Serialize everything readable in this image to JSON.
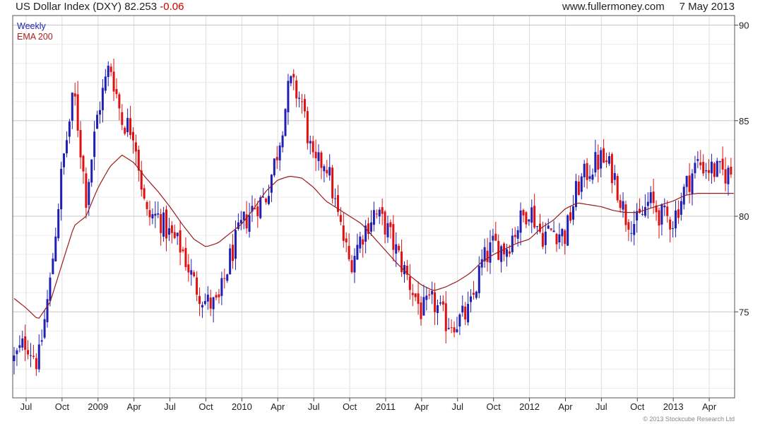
{
  "header": {
    "title": "US Dollar Index (DXY)",
    "last": "82.253",
    "change": "-0.06",
    "source": "www.fullermoney.com",
    "date": "7 May 2013"
  },
  "legend": {
    "series1": "Weekly",
    "series2": "EMA 200"
  },
  "footer": "© 2013 Stockcube Research Ltd",
  "colors": {
    "up": "#1f1fb4",
    "down": "#dd1111",
    "ema": "#9b1c1c",
    "grid": "#dcdcdc"
  },
  "chart_data": {
    "type": "line",
    "title": "US Dollar Index (DXY)",
    "chart_style": "candlestick",
    "ylim": [
      70.5,
      90.5
    ],
    "yticks": [
      75,
      80,
      85,
      90
    ],
    "x_labels": [
      "Jul",
      "Oct",
      "2009",
      "Apr",
      "Jul",
      "Oct",
      "2010",
      "Apr",
      "Jul",
      "Oct",
      "2011",
      "Apr",
      "Jul",
      "Oct",
      "2012",
      "Apr",
      "Jul",
      "Oct",
      "2013",
      "Apr"
    ],
    "x_range": [
      "2008-06",
      "2013-05"
    ],
    "grid": true,
    "axis_side": "right",
    "series": [
      {
        "name": "Weekly",
        "kind": "close",
        "x": [
          "2008-06",
          "2008-07",
          "2008-08",
          "2008-09",
          "2008-10",
          "2008-11",
          "2008-12",
          "2009-01",
          "2009-02",
          "2009-03",
          "2009-04",
          "2009-05",
          "2009-06",
          "2009-07",
          "2009-08",
          "2009-09",
          "2009-10",
          "2009-11",
          "2009-12",
          "2010-01",
          "2010-02",
          "2010-03",
          "2010-04",
          "2010-05",
          "2010-06",
          "2010-07",
          "2010-08",
          "2010-09",
          "2010-10",
          "2010-11",
          "2010-12",
          "2011-01",
          "2011-02",
          "2011-03",
          "2011-04",
          "2011-05",
          "2011-06",
          "2011-07",
          "2011-08",
          "2011-09",
          "2011-10",
          "2011-11",
          "2011-12",
          "2012-01",
          "2012-02",
          "2012-03",
          "2012-04",
          "2012-05",
          "2012-06",
          "2012-07",
          "2012-08",
          "2012-09",
          "2012-10",
          "2012-11",
          "2012-12",
          "2013-01",
          "2013-02",
          "2013-03",
          "2013-04",
          "2013-05"
        ],
        "values": [
          72.5,
          73.5,
          72.3,
          76.5,
          82.5,
          86.5,
          81.0,
          85.5,
          88.0,
          85.0,
          84.5,
          80.0,
          80.0,
          79.0,
          78.3,
          76.5,
          75.5,
          75.3,
          77.8,
          79.5,
          80.5,
          81.0,
          83.5,
          87.0,
          86.0,
          82.5,
          83.0,
          80.0,
          77.5,
          79.0,
          80.2,
          79.5,
          78.0,
          76.5,
          75.0,
          75.5,
          74.5,
          74.5,
          75.0,
          77.5,
          78.5,
          78.3,
          79.5,
          80.5,
          79.0,
          79.3,
          79.0,
          81.5,
          82.5,
          83.0,
          82.3,
          80.0,
          79.6,
          80.8,
          80.0,
          79.8,
          81.5,
          82.8,
          82.5,
          82.25
        ]
      },
      {
        "name": "EMA 200",
        "kind": "line",
        "x": [
          "2008-06",
          "2008-07",
          "2008-08",
          "2008-09",
          "2008-10",
          "2008-11",
          "2008-12",
          "2009-01",
          "2009-02",
          "2009-03",
          "2009-04",
          "2009-05",
          "2009-06",
          "2009-07",
          "2009-08",
          "2009-09",
          "2009-10",
          "2009-11",
          "2009-12",
          "2010-01",
          "2010-02",
          "2010-03",
          "2010-04",
          "2010-05",
          "2010-06",
          "2010-07",
          "2010-08",
          "2010-09",
          "2010-10",
          "2010-11",
          "2010-12",
          "2011-01",
          "2011-02",
          "2011-03",
          "2011-04",
          "2011-05",
          "2011-06",
          "2011-07",
          "2011-08",
          "2011-09",
          "2011-10",
          "2011-11",
          "2011-12",
          "2012-01",
          "2012-02",
          "2012-03",
          "2012-04",
          "2012-05",
          "2012-06",
          "2012-07",
          "2012-08",
          "2012-09",
          "2012-10",
          "2012-11",
          "2012-12",
          "2013-01",
          "2013-02",
          "2013-03",
          "2013-04",
          "2013-05"
        ],
        "values": [
          75.7,
          75.2,
          74.6,
          75.5,
          77.5,
          79.5,
          80.0,
          81.5,
          82.6,
          83.2,
          82.8,
          82.0,
          81.3,
          80.5,
          79.6,
          78.8,
          78.4,
          78.6,
          79.1,
          79.6,
          80.4,
          81.3,
          81.9,
          82.1,
          82.0,
          81.5,
          80.8,
          80.4,
          80.0,
          79.6,
          78.9,
          78.2,
          77.5,
          76.9,
          76.4,
          76.1,
          76.3,
          76.6,
          77.0,
          77.6,
          78.0,
          78.3,
          78.6,
          78.8,
          79.4,
          79.8,
          80.4,
          80.7,
          80.6,
          80.5,
          80.3,
          80.2,
          80.2,
          80.4,
          80.6,
          80.8,
          81.1,
          81.2,
          81.2,
          81.2
        ]
      }
    ]
  }
}
